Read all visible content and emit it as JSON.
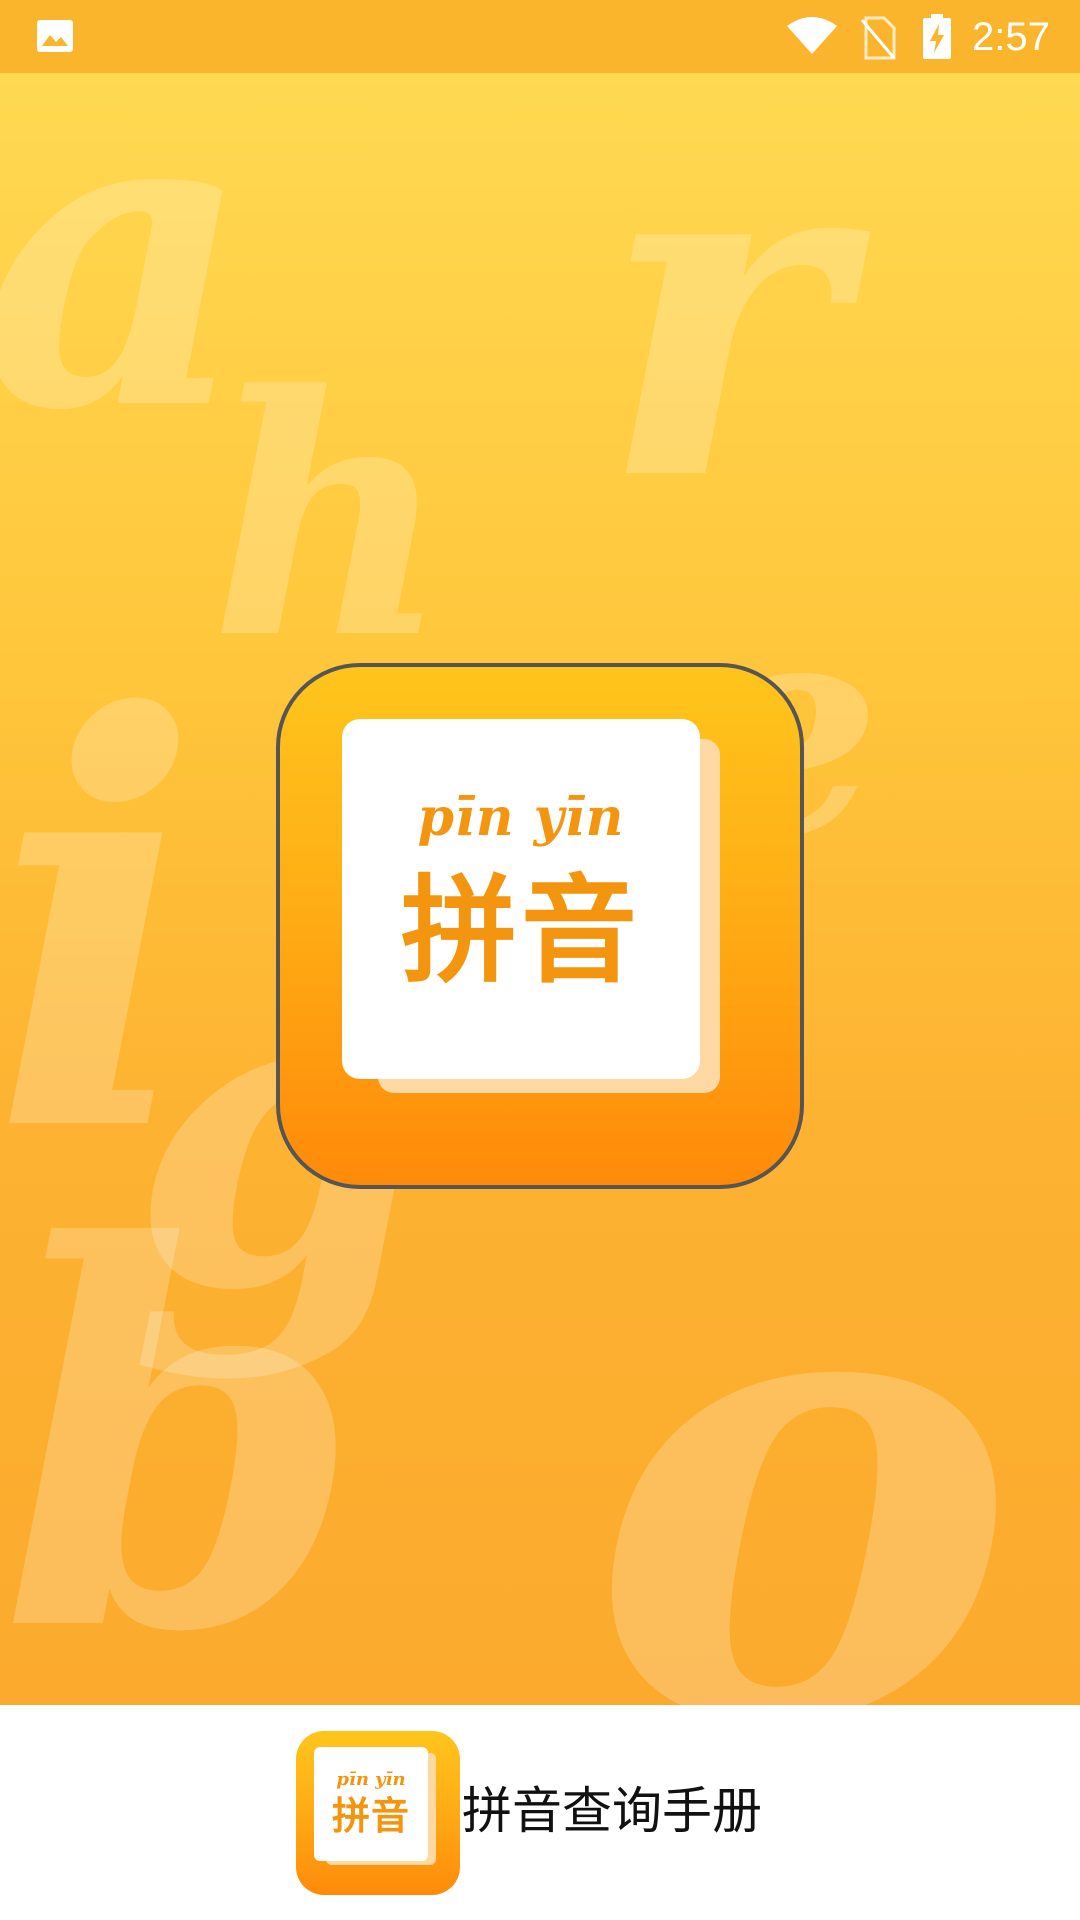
{
  "status_bar": {
    "time": "2:57",
    "icons": [
      "gallery-icon",
      "wifi-icon",
      "no-sim-icon",
      "battery-charging-icon"
    ]
  },
  "splash": {
    "background_letters": [
      "a",
      "r",
      "h",
      "e",
      "i",
      "g",
      "b",
      "o"
    ],
    "icon_pinyin": "pīn yīn",
    "icon_hanzi": "拼音"
  },
  "branding": {
    "icon_pinyin": "pīn yīn",
    "icon_hanzi": "拼音",
    "app_name": "拼音查询手册"
  },
  "colors": {
    "status_bar": "#FBB52C",
    "accent": "#F4950F",
    "background_top": "#FFD952",
    "background_bottom": "#FBAA2D"
  }
}
